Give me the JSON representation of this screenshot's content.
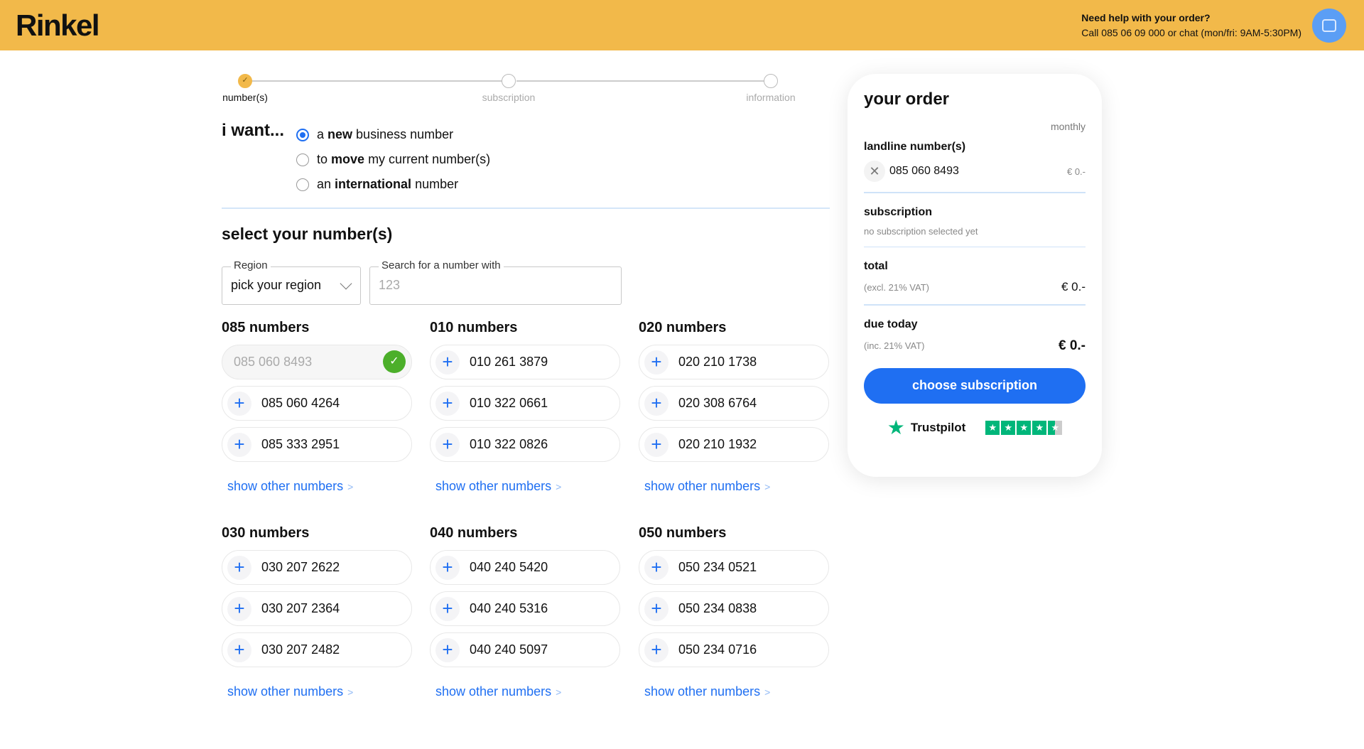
{
  "header": {
    "logo": "Rinkel",
    "help_title": "Need help with your order?",
    "help_text": "Call 085 06 09 000 or chat (mon/fri: 9AM-5:30PM)",
    "brand_color": "#F2B94A"
  },
  "stepper": {
    "steps": [
      {
        "label": "number(s)",
        "done": true
      },
      {
        "label": "subscription"
      },
      {
        "label": "information"
      }
    ]
  },
  "want": {
    "label": "i want...",
    "options": [
      {
        "pre": "a ",
        "bold": "new",
        "post": " business number",
        "selected": true
      },
      {
        "pre": "to ",
        "bold": "move",
        "post": " my current number(s)"
      },
      {
        "pre": "an ",
        "bold": "international",
        "post": " number"
      }
    ]
  },
  "select": {
    "title": "select your number(s)",
    "region_label": "Region",
    "region_value": "pick your region",
    "search_label": "Search for a number with",
    "search_placeholder": "123"
  },
  "groups": [
    {
      "title": "085 numbers",
      "numbers": [
        "085 060 8493",
        "085 060 4264",
        "085 333 2951"
      ],
      "more": "show other numbers"
    },
    {
      "title": "010 numbers",
      "numbers": [
        "010 261 3879",
        "010 322 0661",
        "010 322 0826"
      ],
      "more": "show other numbers"
    },
    {
      "title": "020 numbers",
      "numbers": [
        "020 210 1738",
        "020 308 6764",
        "020 210 1932"
      ],
      "more": "show other numbers"
    },
    {
      "title": "030 numbers",
      "numbers": [
        "030 207 2622",
        "030 207 2364",
        "030 207 2482"
      ],
      "more": "show other numbers"
    },
    {
      "title": "040 numbers",
      "numbers": [
        "040 240 5420",
        "040 240 5316",
        "040 240 5097"
      ],
      "more": "show other numbers"
    },
    {
      "title": "050 numbers",
      "numbers": [
        "050 234 0521",
        "050 234 0838",
        "050 234 0716"
      ],
      "more": "show other numbers"
    }
  ],
  "order": {
    "title": "your order",
    "period": "monthly",
    "landline_title": "landline number(s)",
    "landline_number": "085 060 8493",
    "landline_price": "€ 0.-",
    "subscription_title": "subscription",
    "subscription_text": "no subscription selected yet",
    "total_title": "total",
    "total_note": "(excl. 21% VAT)",
    "total_value": "€ 0.-",
    "due_title": "due today",
    "due_note": "(inc. 21% VAT)",
    "due_value": "€ 0.-",
    "button": "choose subscription",
    "trustpilot": "Trustpilot",
    "rating": 4.5
  }
}
